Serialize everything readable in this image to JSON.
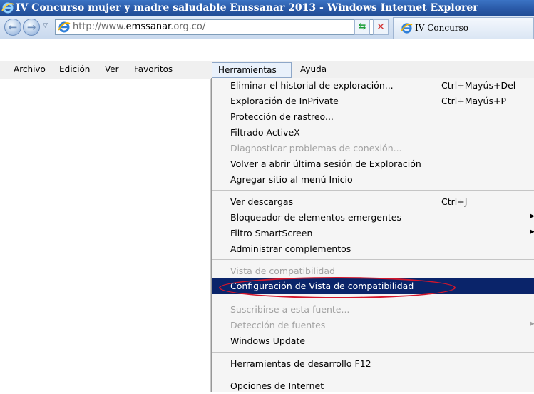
{
  "window": {
    "title": "IV Concurso mujer y madre saludable Emssanar 2013 - Windows Internet Explorer",
    "title_icon": "ie-icon"
  },
  "nav": {
    "back_icon": "back-arrow-icon",
    "forward_icon": "forward-arrow-icon",
    "url_prefix": "http://www.",
    "url_domain": "emssanar",
    "url_suffix": ".org.co/",
    "search_icon": "search-icon",
    "compat_icon": "compatibility-view-icon",
    "stop_icon": "stop-icon",
    "tab_label": "IV Concurso"
  },
  "menubar": {
    "items": [
      "Archivo",
      "Edición",
      "Ver",
      "Favoritos",
      "Herramientas",
      "Ayuda"
    ]
  },
  "tools_menu": {
    "items": [
      {
        "label": "Eliminar el historial de exploración...",
        "shortcut": "Ctrl+Mayús+Del"
      },
      {
        "label": "Exploración de InPrivate",
        "shortcut": "Ctrl+Mayús+P"
      },
      {
        "label": "Protección de rastreo..."
      },
      {
        "label": "Filtrado ActiveX"
      },
      {
        "label": "Diagnosticar problemas de conexión...",
        "disabled": true
      },
      {
        "label": "Volver a abrir última sesión de Exploración"
      },
      {
        "label": "Agregar sitio al menú Inicio"
      },
      {
        "label": "Ver descargas",
        "shortcut": "Ctrl+J"
      },
      {
        "label": "Bloqueador de elementos emergentes",
        "submenu": true
      },
      {
        "label": "Filtro SmartScreen",
        "submenu": true
      },
      {
        "label": "Administrar complementos"
      },
      {
        "label": "Vista de compatibilidad",
        "disabled": true
      },
      {
        "label": "Configuración de Vista de compatibilidad",
        "selected": true
      },
      {
        "label": "Suscribirse a esta fuente...",
        "disabled": true
      },
      {
        "label": "Detección de fuentes",
        "disabled": true,
        "submenu": true
      },
      {
        "label": "Windows Update"
      },
      {
        "label": "Herramientas de desarrollo F12"
      },
      {
        "label": "Opciones de Internet"
      }
    ]
  },
  "colors": {
    "titlebar": "#2a5aa8",
    "selection": "#0a246a",
    "annotation": "#d3162b"
  }
}
